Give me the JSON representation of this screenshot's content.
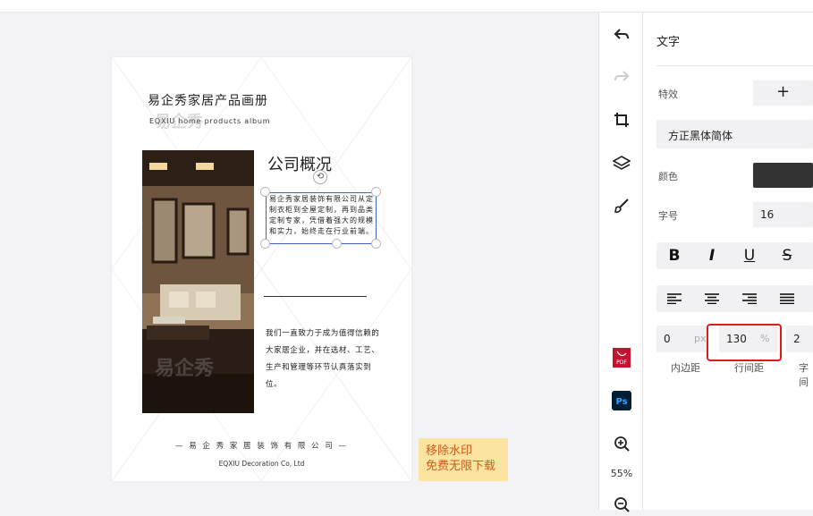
{
  "document": {
    "brand_title": "易企秀家居产品画册",
    "brand_subtitle": "EQXIU home products album",
    "section_title": "公司概况",
    "selected_text": "易企秀家居装饰有限公司从定制衣柜到全屋定制，再到品类定制专家，凭借着强大的规模和实力，始终走在行业前端。",
    "body_text": "我们一直致力于成为值得信赖的大家居企业，并在选材、工艺、生产和管理等环节认真落实到位。",
    "footer_cn": "— 易 企 秀 家 居 装 饰 有 限 公 司 —",
    "footer_en": "EQXIU Decoration Co, Ltd",
    "watermark": "易企秀"
  },
  "remove_watermark": {
    "line1": "移除水印",
    "line2": "免费无限下载"
  },
  "toolbar": {
    "zoom": "55%",
    "icons": [
      "undo-icon",
      "redo-icon",
      "crop-icon",
      "layers-icon",
      "brush-icon",
      "pdf-icon",
      "ps-icon",
      "zoom-in-icon",
      "zoom-out-icon"
    ]
  },
  "panel": {
    "title": "文字",
    "effects_label": "特效",
    "effects_add": "+",
    "font_name": "方正黑体简体",
    "color_label": "颜色",
    "color_value": "#333333",
    "size_label": "字号",
    "size_value": "16",
    "style_buttons": [
      "B",
      "I",
      "U",
      "S"
    ],
    "padding_value": "0",
    "padding_unit": "px",
    "padding_label": "内边距",
    "line_height_value": "130",
    "line_height_unit": "%",
    "line_height_label": "行间距",
    "letter_spacing_value": "2",
    "letter_spacing_label": "字间"
  }
}
